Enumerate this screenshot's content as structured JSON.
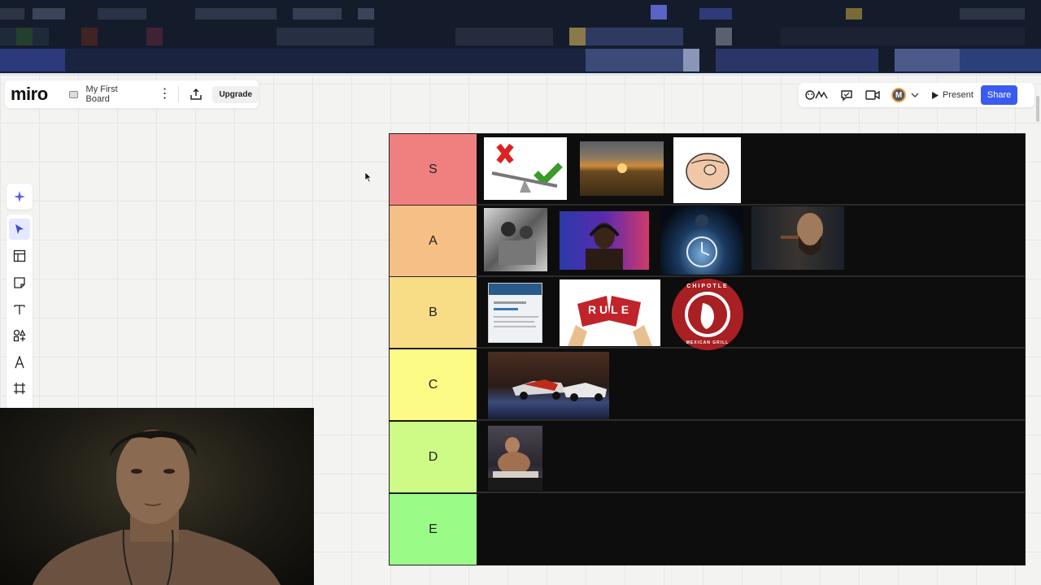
{
  "app": {
    "logo": "miro",
    "board_name": "My First Board",
    "upgrade_label": "Upgrade"
  },
  "topbar_right": {
    "present_label": "Present",
    "share_label": "Share",
    "avatar_initial": "M",
    "accent_color": "#3a5bf0"
  },
  "toolbar": {
    "tools": [
      {
        "name": "select-tool",
        "active": true
      },
      {
        "name": "templates-tool",
        "active": false
      },
      {
        "name": "sticky-note-tool",
        "active": false
      },
      {
        "name": "text-tool",
        "active": false
      },
      {
        "name": "shapes-tool",
        "active": false
      },
      {
        "name": "pen-tool",
        "active": false
      },
      {
        "name": "frame-tool",
        "active": false
      }
    ]
  },
  "tiers": [
    {
      "label": "S",
      "color": "#f08080",
      "items": [
        "scales-balance-image",
        "sunset-field-image",
        "pointing-hand-image"
      ]
    },
    {
      "label": "A",
      "color": "#f6bf85",
      "items": [
        "family-photo-image",
        "headphones-man-image",
        "clock-night-image",
        "cigar-man-image"
      ]
    },
    {
      "label": "B",
      "color": "#f8dc86",
      "items": [
        "phone-screenshot-image",
        "rule-paper-image",
        "chipotle-logo-image"
      ]
    },
    {
      "label": "C",
      "color": "#fbfb86",
      "items": [
        "cars-garage-image"
      ]
    },
    {
      "label": "D",
      "color": "#cdfb86",
      "items": [
        "man-eating-image"
      ]
    },
    {
      "label": "E",
      "color": "#9afb86",
      "items": []
    }
  ],
  "tier_images": {
    "rule_text": "RULE",
    "chipotle_text": "CHIPOTLE",
    "chipotle_sub": "MEXICAN GRILL"
  }
}
